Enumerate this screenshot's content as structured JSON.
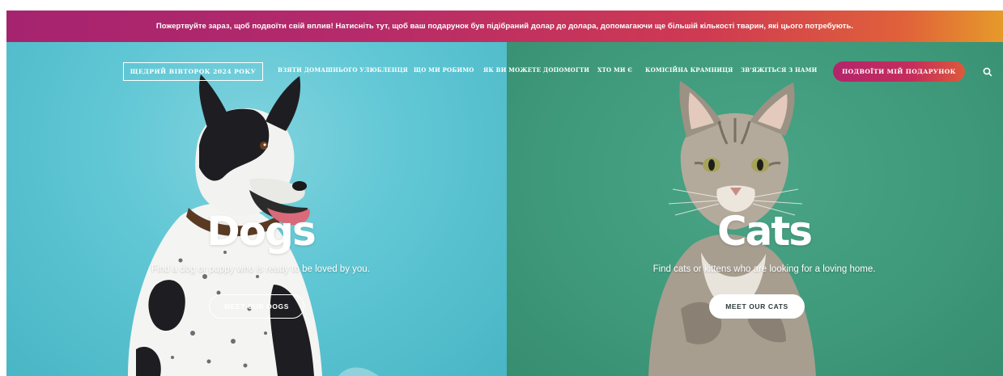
{
  "banner": {
    "text": "Пожертвуйте зараз, щоб подвоїти свій вплив! Натисніть тут, щоб ваш подарунок був підібраний долар до долара, допомагаючи ще більшій кількості тварин, які цього потребують."
  },
  "nav": {
    "giving_tuesday": "ЩЕДРИЙ ВІВТОРОК 2024 РОКУ",
    "items": [
      {
        "label": "ВЗЯТИ ДОМАШНЬОГО УЛЮБЛЕНЦЯ"
      },
      {
        "label": "ЩО МИ РОБИМО"
      },
      {
        "label": "ЯК ВИ МОЖЕТЕ ДОПОМОГТИ"
      },
      {
        "label": "ХТО МИ Є"
      },
      {
        "label": "КОМІСІЙНА КРАМНИЦЯ"
      },
      {
        "label": "ЗВ'ЯЖІТЬСЯ З НАМИ"
      }
    ],
    "cta": "ПОДВОЇТИ МІЙ ПОДАРУНОК",
    "search_icon": "search-icon"
  },
  "hero": {
    "dogs": {
      "title": "Dogs",
      "subtitle": "Find a dog or puppy who is ready to be loved by you.",
      "button": "MEET OUR DOGS"
    },
    "cats": {
      "title": "Cats",
      "subtitle": "Find cats or kittens who are looking for a loving home.",
      "button": "MEET OUR CATS"
    }
  },
  "colors": {
    "banner_start": "#a6236f",
    "banner_end": "#e69a2a",
    "dogs_bg": "#5fc6d4",
    "cats_bg": "#3f9a7b",
    "cta_gradient_start": "#b3246c"
  }
}
